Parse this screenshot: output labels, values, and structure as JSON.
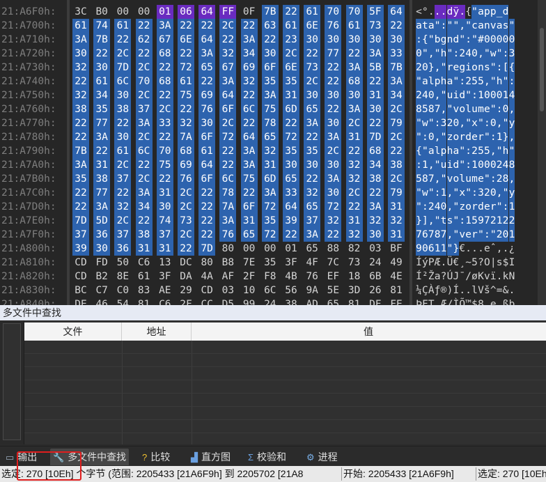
{
  "hex_view": {
    "rows": [
      {
        "addr": "21:A6F0h:",
        "hex": [
          "3C",
          "B0",
          "00",
          "00",
          "01",
          "06",
          "64",
          "FF",
          "0F",
          "7B",
          "22",
          "61",
          "70",
          "70",
          "5F",
          "64"
        ],
        "ascii": "<°...dÿ.{\"app_d"
      },
      {
        "addr": "21:A700h:",
        "hex": [
          "61",
          "74",
          "61",
          "22",
          "3A",
          "22",
          "22",
          "2C",
          "22",
          "63",
          "61",
          "6E",
          "76",
          "61",
          "73",
          "22"
        ],
        "ascii": "ata\":\"\",\"canvas\""
      },
      {
        "addr": "21:A710h:",
        "hex": [
          "3A",
          "7B",
          "22",
          "62",
          "67",
          "6E",
          "64",
          "22",
          "3A",
          "22",
          "23",
          "30",
          "30",
          "30",
          "30",
          "30"
        ],
        "ascii": ":{\"bgnd\":\"#00000"
      },
      {
        "addr": "21:A720h:",
        "hex": [
          "30",
          "22",
          "2C",
          "22",
          "68",
          "22",
          "3A",
          "32",
          "34",
          "30",
          "2C",
          "22",
          "77",
          "22",
          "3A",
          "33"
        ],
        "ascii": "0\",\"h\":240,\"w\":3"
      },
      {
        "addr": "21:A730h:",
        "hex": [
          "32",
          "30",
          "7D",
          "2C",
          "22",
          "72",
          "65",
          "67",
          "69",
          "6F",
          "6E",
          "73",
          "22",
          "3A",
          "5B",
          "7B"
        ],
        "ascii": "20},\"regions\":[{"
      },
      {
        "addr": "21:A740h:",
        "hex": [
          "22",
          "61",
          "6C",
          "70",
          "68",
          "61",
          "22",
          "3A",
          "32",
          "35",
          "35",
          "2C",
          "22",
          "68",
          "22",
          "3A"
        ],
        "ascii": "\"alpha\":255,\"h\":"
      },
      {
        "addr": "21:A750h:",
        "hex": [
          "32",
          "34",
          "30",
          "2C",
          "22",
          "75",
          "69",
          "64",
          "22",
          "3A",
          "31",
          "30",
          "30",
          "30",
          "31",
          "34"
        ],
        "ascii": "240,\"uid\":100014"
      },
      {
        "addr": "21:A760h:",
        "hex": [
          "38",
          "35",
          "38",
          "37",
          "2C",
          "22",
          "76",
          "6F",
          "6C",
          "75",
          "6D",
          "65",
          "22",
          "3A",
          "30",
          "2C"
        ],
        "ascii": "8587,\"volume\":0,"
      },
      {
        "addr": "21:A770h:",
        "hex": [
          "22",
          "77",
          "22",
          "3A",
          "33",
          "32",
          "30",
          "2C",
          "22",
          "78",
          "22",
          "3A",
          "30",
          "2C",
          "22",
          "79"
        ],
        "ascii": "\"w\":320,\"x\":0,\"y"
      },
      {
        "addr": "21:A780h:",
        "hex": [
          "22",
          "3A",
          "30",
          "2C",
          "22",
          "7A",
          "6F",
          "72",
          "64",
          "65",
          "72",
          "22",
          "3A",
          "31",
          "7D",
          "2C"
        ],
        "ascii": "\":0,\"zorder\":1},"
      },
      {
        "addr": "21:A790h:",
        "hex": [
          "7B",
          "22",
          "61",
          "6C",
          "70",
          "68",
          "61",
          "22",
          "3A",
          "32",
          "35",
          "35",
          "2C",
          "22",
          "68",
          "22"
        ],
        "ascii": "{\"alpha\":255,\"h\""
      },
      {
        "addr": "21:A7A0h:",
        "hex": [
          "3A",
          "31",
          "2C",
          "22",
          "75",
          "69",
          "64",
          "22",
          "3A",
          "31",
          "30",
          "30",
          "30",
          "32",
          "34",
          "38"
        ],
        "ascii": ":1,\"uid\":1000248"
      },
      {
        "addr": "21:A7B0h:",
        "hex": [
          "35",
          "38",
          "37",
          "2C",
          "22",
          "76",
          "6F",
          "6C",
          "75",
          "6D",
          "65",
          "22",
          "3A",
          "32",
          "38",
          "2C"
        ],
        "ascii": "587,\"volume\":28,"
      },
      {
        "addr": "21:A7C0h:",
        "hex": [
          "22",
          "77",
          "22",
          "3A",
          "31",
          "2C",
          "22",
          "78",
          "22",
          "3A",
          "33",
          "32",
          "30",
          "2C",
          "22",
          "79"
        ],
        "ascii": "\"w\":1,\"x\":320,\"y"
      },
      {
        "addr": "21:A7D0h:",
        "hex": [
          "22",
          "3A",
          "32",
          "34",
          "30",
          "2C",
          "22",
          "7A",
          "6F",
          "72",
          "64",
          "65",
          "72",
          "22",
          "3A",
          "31"
        ],
        "ascii": "\":240,\"zorder\":1"
      },
      {
        "addr": "21:A7E0h:",
        "hex": [
          "7D",
          "5D",
          "2C",
          "22",
          "74",
          "73",
          "22",
          "3A",
          "31",
          "35",
          "39",
          "37",
          "32",
          "31",
          "32",
          "32"
        ],
        "ascii": "}],\"ts\":15972122"
      },
      {
        "addr": "21:A7F0h:",
        "hex": [
          "37",
          "36",
          "37",
          "38",
          "37",
          "2C",
          "22",
          "76",
          "65",
          "72",
          "22",
          "3A",
          "22",
          "32",
          "30",
          "31"
        ],
        "ascii": "76787,\"ver\":\"201"
      },
      {
        "addr": "21:A800h:",
        "hex": [
          "39",
          "30",
          "36",
          "31",
          "31",
          "22",
          "7D",
          "80",
          "00",
          "00",
          "01",
          "65",
          "88",
          "82",
          "03",
          "BF"
        ],
        "ascii": "90611\"}€...eˆ‚.¿"
      },
      {
        "addr": "21:A810h:",
        "hex": [
          "CD",
          "FD",
          "50",
          "C6",
          "13",
          "DC",
          "80",
          "B8",
          "7E",
          "35",
          "3F",
          "4F",
          "7C",
          "73",
          "24",
          "49"
        ],
        "ascii": "ÍýPÆ.Ü€¸~5?O|s$I"
      },
      {
        "addr": "21:A820h:",
        "hex": [
          "CD",
          "B2",
          "8E",
          "61",
          "3F",
          "DA",
          "4A",
          "AF",
          "2F",
          "F8",
          "4B",
          "76",
          "EF",
          "18",
          "6B",
          "4E"
        ],
        "ascii": "Í²Ža?ÚJ¯/øKvï.kN"
      },
      {
        "addr": "21:A830h:",
        "hex": [
          "BC",
          "C7",
          "C0",
          "83",
          "AE",
          "29",
          "CD",
          "03",
          "10",
          "6C",
          "56",
          "9A",
          "5E",
          "3D",
          "26",
          "81"
        ],
        "ascii": "¼ÇÀƒ®)Í..lVš^=&."
      },
      {
        "addr": "21:A840h:",
        "hex": [
          "DE",
          "46",
          "54",
          "81",
          "C6",
          "2F",
          "CC",
          "D5",
          "99",
          "24",
          "38",
          "AD",
          "65",
          "81",
          "DF",
          "FE"
        ],
        "ascii": "ÞFT.Æ/ÌÕ™$8­e.ßþ"
      }
    ]
  },
  "find_panel": {
    "title": "多文件中查找",
    "columns": [
      "文件",
      "地址",
      "值"
    ]
  },
  "bottom_tabs": [
    {
      "label": "输出",
      "icon": "output-icon"
    },
    {
      "label": "多文件中查找",
      "icon": "find-in-files-icon"
    },
    {
      "label": "比较",
      "icon": "compare-icon"
    },
    {
      "label": "直方图",
      "icon": "histogram-icon"
    },
    {
      "label": "校验和",
      "icon": "checksum-icon"
    },
    {
      "label": "进程",
      "icon": "process-icon"
    }
  ],
  "status_bar": {
    "selection": "选定: 270 [10Eh] 个字节 (范围: 2205433 [21A6F9h] 到 2205702 [21A8",
    "start": "开始: 2205433 [21A6F9h]",
    "selected_end": "选定: 270 [10Eh"
  },
  "colors": {
    "selection": "#2d63ae",
    "highlight": "#6a2bc0",
    "annotation": "#e01e1e"
  }
}
